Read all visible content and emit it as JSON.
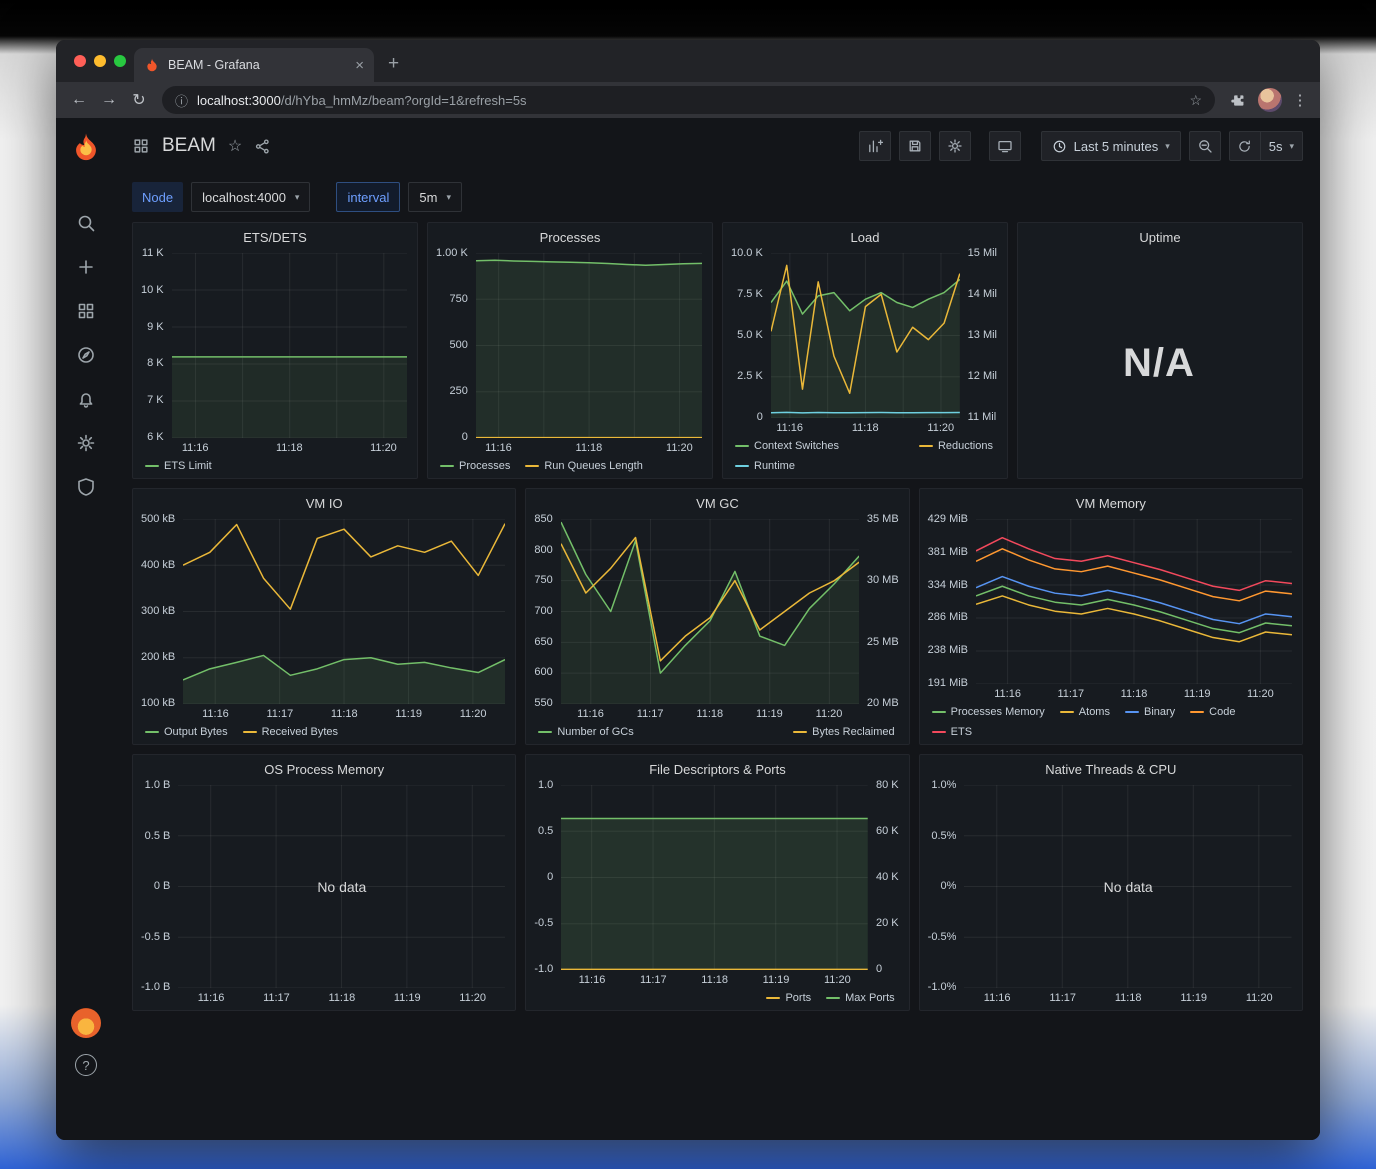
{
  "browser": {
    "tab_title": "BEAM - Grafana",
    "url_host": "localhost:3000",
    "url_path": "/d/hYba_hmMz/beam?orgId=1&refresh=5s"
  },
  "icons": {
    "tab_close": "×",
    "new_tab": "+",
    "back": "←",
    "forward": "→",
    "reload": "↻",
    "info": "ⓘ",
    "star": "☆",
    "more": "⋮",
    "chevron_down": "▾",
    "help": "?"
  },
  "grafana": {
    "title": "BEAM",
    "time_range": "Last 5 minutes",
    "refresh": "5s",
    "variables": [
      {
        "label": "Node",
        "value": "localhost:4000"
      },
      {
        "label": "interval",
        "value": "5m"
      }
    ]
  },
  "palette": {
    "green": "#73BF69",
    "yellow": "#EAB839",
    "blue": "#5794F2",
    "orange": "#FF9830",
    "red": "#F2495C",
    "teal": "#6ED0E0"
  },
  "panels": [
    {
      "title": "ETS/DETS",
      "type": "timeseries",
      "y": {
        "min": 6000,
        "max": 11000,
        "ticks": [
          "11 K",
          "10 K",
          "9 K",
          "8 K",
          "7 K",
          "6 K"
        ]
      },
      "x_ticks": [
        "11:16",
        "11:18",
        "11:20"
      ],
      "x_pos": [
        10,
        50,
        90
      ],
      "series": [
        {
          "name": "ETS Limit",
          "color": "#73BF69",
          "axis": "y",
          "fill": true,
          "fill_opacity": 0.1,
          "values": [
            8192,
            8192,
            8192,
            8192,
            8192,
            8192,
            8192,
            8192,
            8192,
            8192,
            8192,
            8192,
            8192
          ]
        }
      ],
      "legend": [
        {
          "label": "ETS Limit",
          "color": "#73BF69"
        }
      ]
    },
    {
      "title": "Processes",
      "type": "timeseries",
      "y": {
        "min": 0,
        "max": 1000,
        "ticks": [
          "1.00 K",
          "750",
          "500",
          "250",
          "0"
        ]
      },
      "x_ticks": [
        "11:16",
        "11:18",
        "11:20"
      ],
      "x_pos": [
        10,
        50,
        90
      ],
      "series": [
        {
          "name": "Processes",
          "color": "#73BF69",
          "axis": "y",
          "fill": true,
          "fill_opacity": 0.12,
          "values": [
            958,
            961,
            957,
            955,
            952,
            950,
            947,
            943,
            938,
            934,
            938,
            942,
            944
          ]
        },
        {
          "name": "Run Queues Length",
          "color": "#EAB839",
          "axis": "y",
          "fill": false,
          "values": [
            2,
            2,
            2,
            2,
            2,
            2,
            2,
            2,
            2,
            2,
            2,
            2,
            2
          ]
        }
      ],
      "legend": [
        {
          "label": "Processes",
          "color": "#73BF69"
        },
        {
          "label": "Run Queues Length",
          "color": "#EAB839"
        }
      ]
    },
    {
      "title": "Load",
      "type": "timeseries",
      "y": {
        "min": 0,
        "max": 10000,
        "ticks": [
          "10.0 K",
          "7.5 K",
          "5.0 K",
          "2.5 K",
          "0"
        ]
      },
      "y2": {
        "min": 11,
        "max": 15,
        "ticks": [
          "15 Mil",
          "14 Mil",
          "13 Mil",
          "12 Mil",
          "11 Mil"
        ]
      },
      "x_ticks": [
        "11:16",
        "11:18",
        "11:20"
      ],
      "x_pos": [
        10,
        50,
        90
      ],
      "series": [
        {
          "name": "Context Switches",
          "color": "#73BF69",
          "axis": "y",
          "fill": true,
          "fill_opacity": 0.12,
          "values": [
            7000,
            8300,
            6300,
            7400,
            7600,
            6500,
            7200,
            7600,
            7000,
            6700,
            7200,
            7600,
            8400
          ]
        },
        {
          "name": "Reductions",
          "color": "#EAB839",
          "axis": "y2",
          "fill": false,
          "values": [
            13.1,
            14.7,
            11.7,
            14.3,
            12.5,
            11.6,
            13.7,
            14.0,
            12.6,
            13.2,
            12.9,
            13.3,
            14.5
          ]
        },
        {
          "name": "Runtime",
          "color": "#6ED0E0",
          "axis": "y",
          "fill": false,
          "values": [
            320,
            340,
            310,
            330,
            320,
            315,
            325,
            330,
            320,
            318,
            322,
            326,
            330
          ]
        }
      ],
      "legend": [
        {
          "label": "Context Switches",
          "color": "#73BF69"
        },
        {
          "label": "Reductions",
          "color": "#EAB839",
          "right": true
        },
        {
          "label": "Runtime",
          "color": "#6ED0E0",
          "break_before": true
        }
      ]
    },
    {
      "title": "Uptime",
      "type": "stat",
      "value": "N/A"
    },
    {
      "title": "VM IO",
      "type": "timeseries",
      "y": {
        "min": 100000,
        "max": 500000,
        "ticks": [
          "500 kB",
          "400 kB",
          "300 kB",
          "200 kB",
          "100 kB"
        ]
      },
      "x_ticks": [
        "11:16",
        "11:17",
        "11:18",
        "11:19",
        "11:20"
      ],
      "x_pos": [
        10,
        30,
        50,
        70,
        90
      ],
      "series": [
        {
          "name": "Output Bytes",
          "color": "#73BF69",
          "axis": "y",
          "fill": true,
          "fill_opacity": 0.12,
          "values": [
            152000,
            176000,
            190000,
            205000,
            162000,
            176000,
            196000,
            200000,
            186000,
            190000,
            178000,
            168000,
            196000
          ]
        },
        {
          "name": "Received Bytes",
          "color": "#EAB839",
          "axis": "y",
          "fill": false,
          "values": [
            400000,
            428000,
            488000,
            372000,
            305000,
            458000,
            478000,
            418000,
            442000,
            428000,
            452000,
            378000,
            490000
          ]
        }
      ],
      "legend": [
        {
          "label": "Output Bytes",
          "color": "#73BF69"
        },
        {
          "label": "Received Bytes",
          "color": "#EAB839"
        }
      ]
    },
    {
      "title": "VM GC",
      "type": "timeseries",
      "y": {
        "min": 550,
        "max": 850,
        "ticks": [
          "850",
          "800",
          "750",
          "700",
          "650",
          "600",
          "550"
        ]
      },
      "y2": {
        "min": 20,
        "max": 35,
        "ticks": [
          "35 MB",
          "30 MB",
          "25 MB",
          "20 MB"
        ]
      },
      "x_ticks": [
        "11:16",
        "11:17",
        "11:18",
        "11:19",
        "11:20"
      ],
      "x_pos": [
        10,
        30,
        50,
        70,
        90
      ],
      "series": [
        {
          "name": "Number of GCs",
          "color": "#73BF69",
          "axis": "y",
          "fill": true,
          "fill_opacity": 0.1,
          "values": [
            845,
            760,
            700,
            815,
            600,
            645,
            685,
            765,
            660,
            645,
            705,
            745,
            790
          ]
        },
        {
          "name": "Bytes Reclaimed",
          "color": "#EAB839",
          "axis": "y2",
          "fill": false,
          "values": [
            33,
            29,
            31,
            33.5,
            23.5,
            25.5,
            27,
            30,
            26,
            27.5,
            29,
            30,
            31.5
          ]
        }
      ],
      "legend": [
        {
          "label": "Number of GCs",
          "color": "#73BF69"
        },
        {
          "label": "Bytes Reclaimed",
          "color": "#EAB839",
          "right": true
        }
      ]
    },
    {
      "title": "VM Memory",
      "type": "timeseries",
      "y": {
        "min": 191,
        "max": 429,
        "ticks": [
          "429 MiB",
          "381 MiB",
          "334 MiB",
          "286 MiB",
          "238 MiB",
          "191 MiB"
        ]
      },
      "x_ticks": [
        "11:16",
        "11:17",
        "11:18",
        "11:19",
        "11:20"
      ],
      "x_pos": [
        10,
        30,
        50,
        70,
        90
      ],
      "series": [
        {
          "name": "ETS",
          "color": "#F2495C",
          "axis": "y",
          "fill": false,
          "values": [
            383,
            402,
            386,
            372,
            368,
            376,
            366,
            356,
            344,
            332,
            326,
            340,
            336
          ]
        },
        {
          "name": "Code",
          "color": "#FF9830",
          "axis": "y",
          "fill": false,
          "values": [
            368,
            386,
            370,
            357,
            353,
            361,
            351,
            341,
            329,
            317,
            311,
            325,
            321
          ]
        },
        {
          "name": "Binary",
          "color": "#5794F2",
          "axis": "y",
          "fill": false,
          "values": [
            330,
            346,
            332,
            322,
            318,
            326,
            318,
            308,
            296,
            284,
            278,
            292,
            288
          ]
        },
        {
          "name": "Processes Memory",
          "color": "#73BF69",
          "axis": "y",
          "fill": false,
          "values": [
            318,
            332,
            318,
            309,
            305,
            313,
            305,
            295,
            283,
            271,
            265,
            279,
            275
          ]
        },
        {
          "name": "Atoms",
          "color": "#EAB839",
          "axis": "y",
          "fill": false,
          "values": [
            306,
            318,
            305,
            296,
            292,
            300,
            292,
            282,
            270,
            258,
            252,
            266,
            262
          ]
        }
      ],
      "legend": [
        {
          "label": "Processes Memory",
          "color": "#73BF69"
        },
        {
          "label": "Atoms",
          "color": "#EAB839"
        },
        {
          "label": "Binary",
          "color": "#5794F2"
        },
        {
          "label": "Code",
          "color": "#FF9830"
        },
        {
          "label": "ETS",
          "color": "#F2495C",
          "break_before": true
        }
      ]
    },
    {
      "title": "OS Process Memory",
      "type": "no_data",
      "message": "No data",
      "y": {
        "min": -1,
        "max": 1,
        "ticks": [
          "1.0 B",
          "0.5 B",
          "0 B",
          "-0.5 B",
          "-1.0 B"
        ]
      },
      "x_ticks": [
        "11:16",
        "11:17",
        "11:18",
        "11:19",
        "11:20"
      ],
      "x_pos": [
        10,
        30,
        50,
        70,
        90
      ],
      "series": []
    },
    {
      "title": "File Descriptors & Ports",
      "type": "timeseries",
      "y": {
        "min": -1,
        "max": 1,
        "ticks": [
          "1.0",
          "0.5",
          "0",
          "-0.5",
          "-1.0"
        ]
      },
      "y2": {
        "min": 0,
        "max": 80000,
        "ticks": [
          "80 K",
          "60 K",
          "40 K",
          "20 K",
          "0"
        ]
      },
      "x_ticks": [
        "11:16",
        "11:17",
        "11:18",
        "11:19",
        "11:20"
      ],
      "x_pos": [
        10,
        30,
        50,
        70,
        90
      ],
      "series": [
        {
          "name": "Max Ports",
          "color": "#73BF69",
          "axis": "y2",
          "fill": true,
          "fill_opacity": 0.15,
          "values": [
            65536,
            65536,
            65536,
            65536,
            65536,
            65536,
            65536,
            65536,
            65536,
            65536,
            65536,
            65536,
            65536
          ]
        },
        {
          "name": "Ports",
          "color": "#EAB839",
          "axis": "y2",
          "fill": false,
          "values": [
            300,
            300,
            300,
            300,
            300,
            300,
            300,
            300,
            300,
            300,
            300,
            300,
            300
          ]
        }
      ],
      "legend_align": "right",
      "legend": [
        {
          "label": "Ports",
          "color": "#EAB839"
        },
        {
          "label": "Max Ports",
          "color": "#73BF69"
        }
      ]
    },
    {
      "title": "Native Threads & CPU",
      "type": "no_data",
      "message": "No data",
      "y": {
        "min": -1,
        "max": 1,
        "ticks": [
          "1.0%",
          "0.5%",
          "0%",
          "-0.5%",
          "-1.0%"
        ]
      },
      "x_ticks": [
        "11:16",
        "11:17",
        "11:18",
        "11:19",
        "11:20"
      ],
      "x_pos": [
        10,
        30,
        50,
        70,
        90
      ],
      "series": []
    }
  ]
}
